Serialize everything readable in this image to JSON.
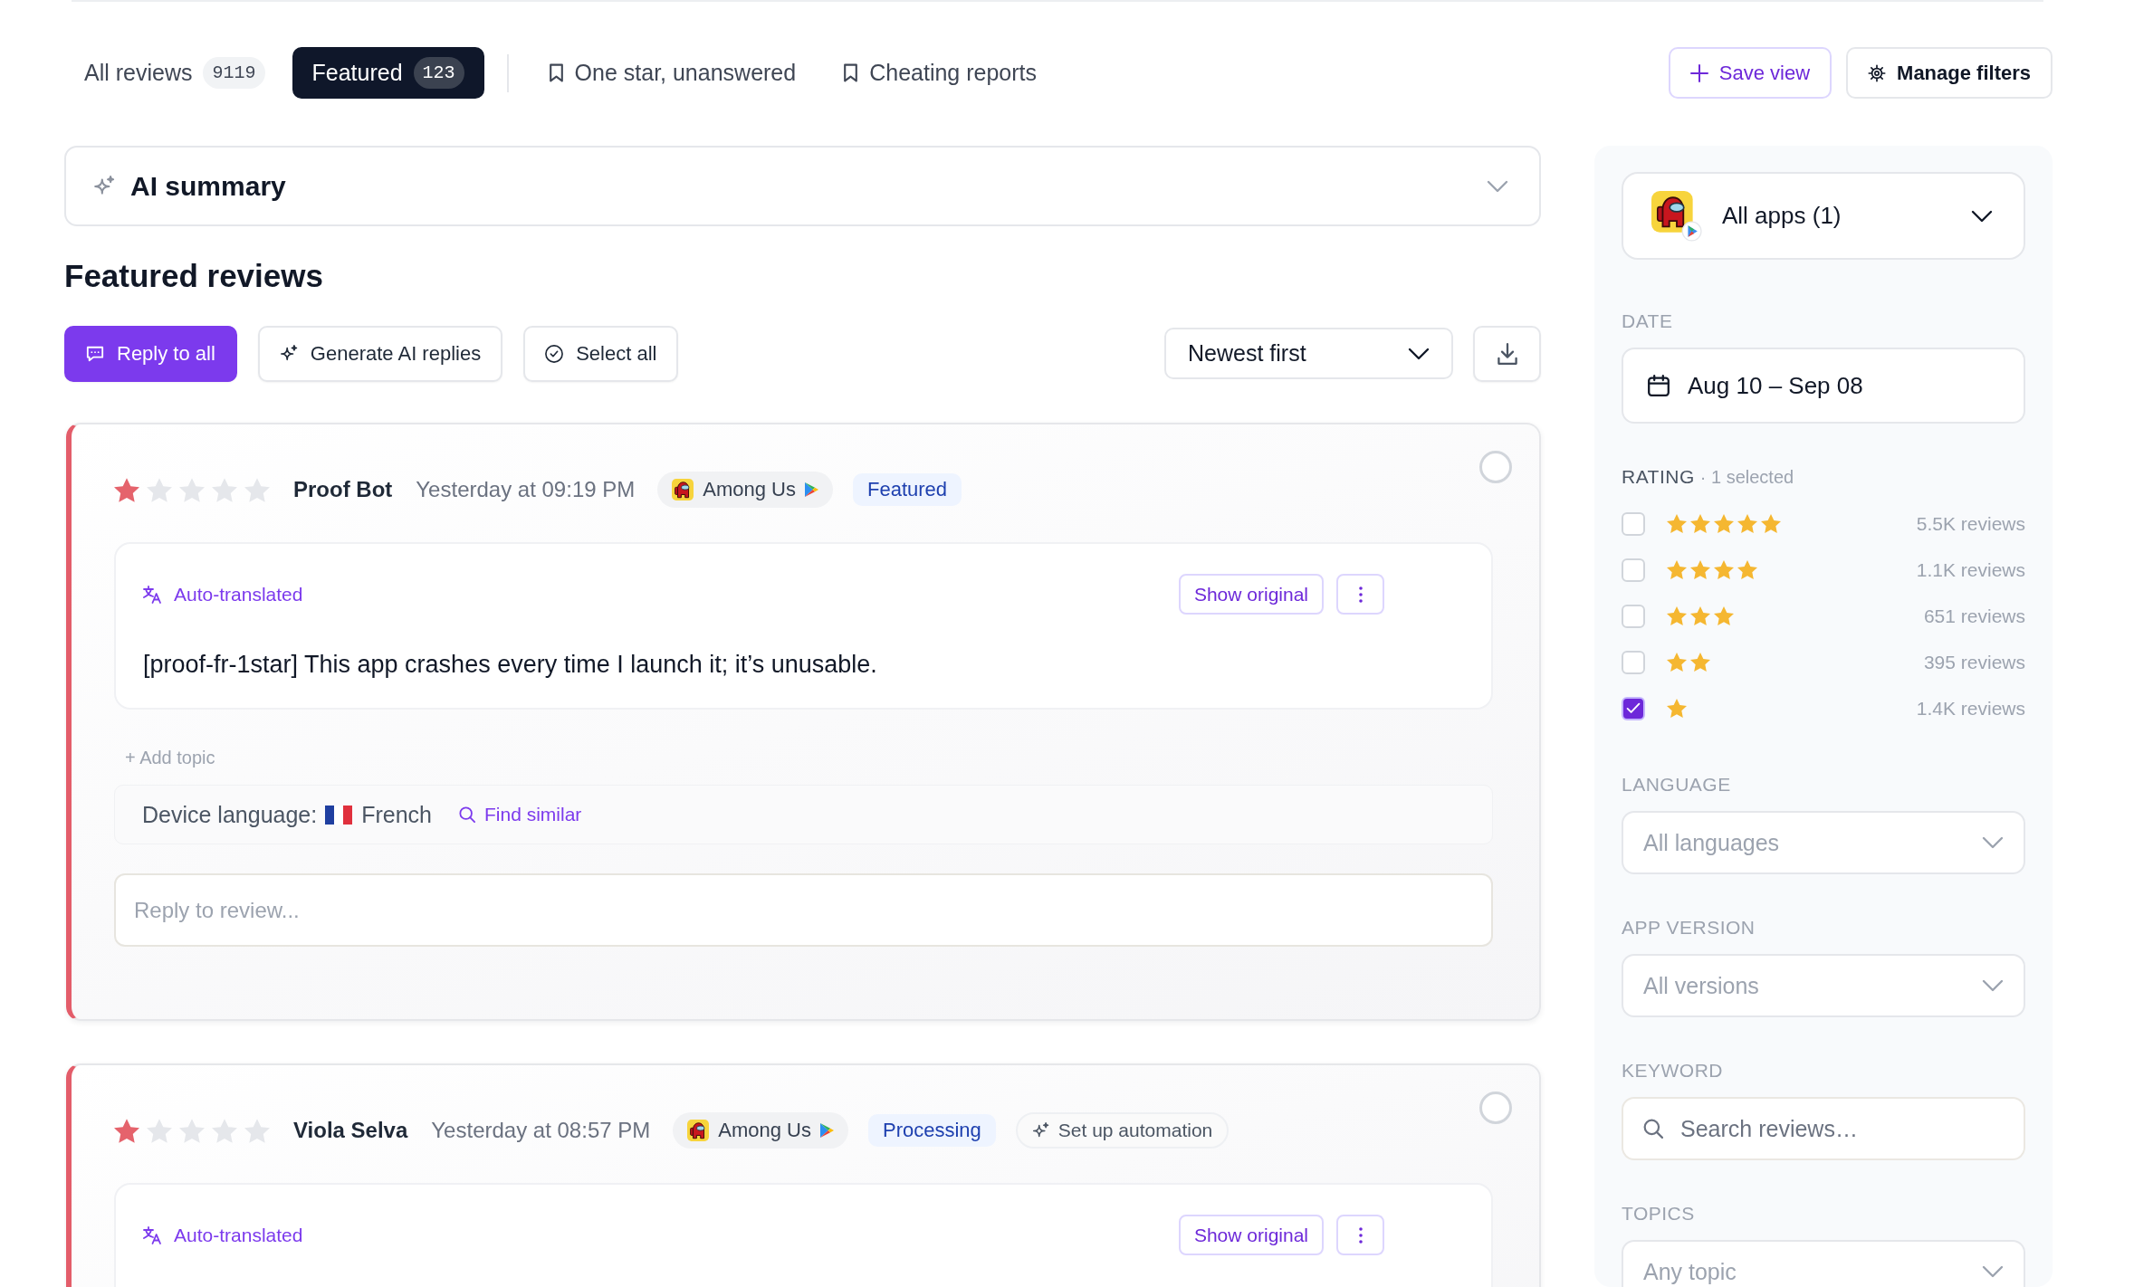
{
  "tabs": [
    {
      "label": "All reviews",
      "count": "9119",
      "kind": "count",
      "selected": false
    },
    {
      "label": "Featured",
      "count": "123",
      "kind": "count",
      "selected": true
    },
    {
      "label": "One star, unanswered",
      "kind": "saved",
      "selected": false
    },
    {
      "label": "Cheating reports",
      "kind": "saved",
      "selected": false
    }
  ],
  "view_actions": [
    {
      "label": "Save view",
      "kind": "add"
    },
    {
      "label": "Manage filters",
      "kind": "settings"
    }
  ],
  "ai_summary": {
    "title": "AI summary"
  },
  "section_title": "Featured reviews",
  "toolbar": {
    "actions": [
      {
        "label": "Reply to all",
        "kind": "reply"
      },
      {
        "label": "Generate AI replies",
        "kind": "generate"
      },
      {
        "label": "Select all",
        "kind": "select"
      }
    ],
    "sort": "Newest first"
  },
  "reviews": [
    {
      "stars": 1,
      "author": "Proof Bot",
      "time": "Yesterday at 09:19 PM",
      "app": "Among Us",
      "status": "Featured",
      "selected": false,
      "translation": "Auto-translated",
      "show_original": "Show original",
      "text": "[proof-fr-1star] This app crashes every time I launch it; it’s unusable.",
      "add_topic": "+ Add topic",
      "device_language_label": "Device language:",
      "device_language": "French",
      "find_similar": "Find similar",
      "reply_placeholder": "Reply to review..."
    },
    {
      "stars": 1,
      "author": "Viola Selva",
      "time": "Yesterday at 08:57 PM",
      "app": "Among Us",
      "status": "Processing",
      "automation": "Set up automation",
      "selected": false,
      "translation": "Auto-translated",
      "show_original": "Show original"
    }
  ],
  "filters": {
    "app_select": "All apps (1)",
    "date": {
      "label": "DATE",
      "value": "Aug 10 – Sep 08"
    },
    "rating": {
      "label": "RATING",
      "note": "· 1 selected",
      "active": true,
      "options": [
        {
          "stars": 5,
          "count": "5.5K reviews",
          "checked": false
        },
        {
          "stars": 4,
          "count": "1.1K reviews",
          "checked": false
        },
        {
          "stars": 3,
          "count": "651 reviews",
          "checked": false
        },
        {
          "stars": 2,
          "count": "395 reviews",
          "checked": false
        },
        {
          "stars": 1,
          "count": "1.4K reviews",
          "checked": true
        }
      ]
    },
    "fields": [
      {
        "label": "LANGUAGE",
        "placeholder": "All languages",
        "kind": "select"
      },
      {
        "label": "APP VERSION",
        "placeholder": "All versions",
        "kind": "select"
      },
      {
        "label": "KEYWORD",
        "placeholder": "Search reviews…",
        "kind": "search"
      },
      {
        "label": "TOPICS",
        "placeholder": "Any topic",
        "kind": "select"
      }
    ]
  }
}
